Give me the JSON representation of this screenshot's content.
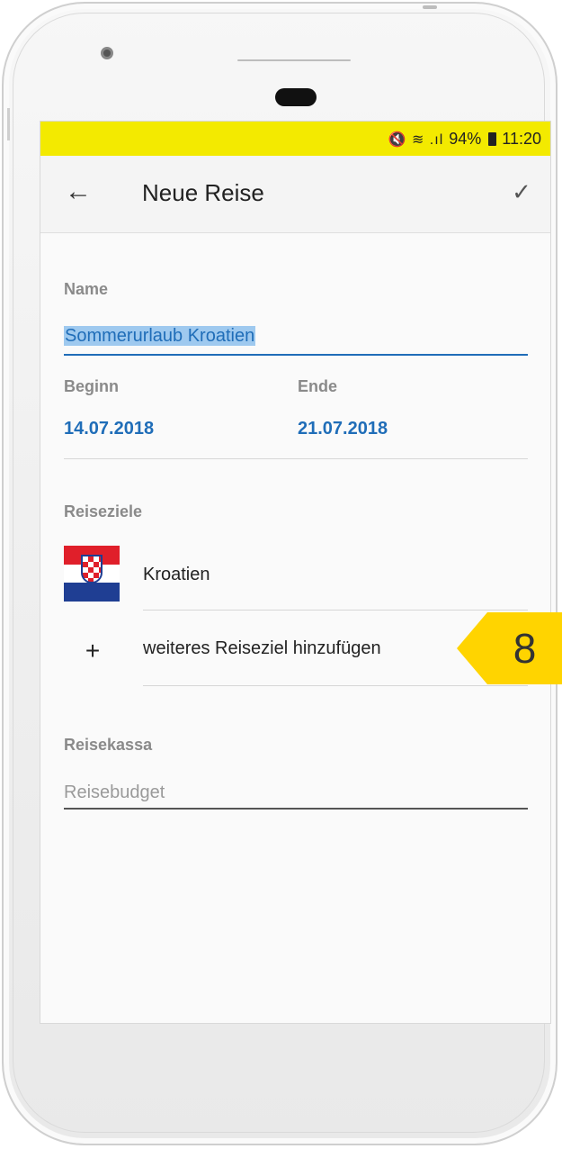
{
  "statusbar": {
    "icons": "🔇 ≋ .ıl",
    "battery": "94%",
    "time": "11:20"
  },
  "appbar": {
    "title": "Neue Reise",
    "back_icon": "arrow-back-icon",
    "confirm_icon": "check-icon"
  },
  "form": {
    "name_label": "Name",
    "name_value": "Sommerurlaub Kroatien",
    "begin_label": "Beginn",
    "begin_value": "14.07.2018",
    "end_label": "Ende",
    "end_value": "21.07.2018",
    "destinations_label": "Reiseziele",
    "destinations": [
      {
        "name": "Kroatien",
        "flag": "croatia-flag"
      }
    ],
    "add_destination_label": "weiteres Reiseziel hinzufügen",
    "budget_label": "Reisekassa",
    "budget_placeholder": "Reisebudget",
    "budget_value": ""
  },
  "callout": {
    "step": "8",
    "color": "#ffd400"
  },
  "colors": {
    "statusbar": "#f3ea00",
    "accent": "#1f6db8",
    "selection": "#9ec9ef"
  }
}
